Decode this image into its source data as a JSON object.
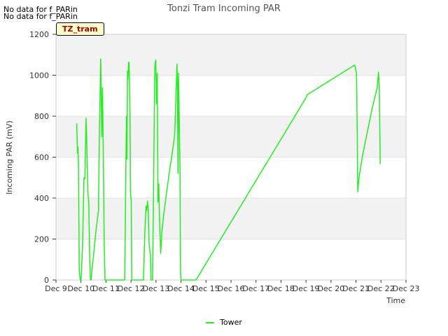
{
  "notes": [
    "No data for f_PARin",
    "No data for f_PARin"
  ],
  "site_tag": "TZ_tram",
  "colors": {
    "series": "#22ee22",
    "band": "#f2f2f2",
    "grid": "#dddddd"
  },
  "chart_data": {
    "type": "line",
    "title": "Tonzi Tram Incoming PAR",
    "xlabel": "Time",
    "ylabel": "Incoming PAR (mV)",
    "xlim": [
      9,
      23
    ],
    "ylim": [
      0,
      1200
    ],
    "x_ticks": [
      9,
      10,
      11,
      12,
      13,
      14,
      15,
      16,
      17,
      18,
      19,
      20,
      21,
      22,
      23
    ],
    "x_tick_labels": [
      "Dec 9",
      "Dec 10",
      "Dec 11",
      "Dec 12",
      "Dec 13",
      "Dec 14",
      "Dec 15",
      "Dec 16",
      "Dec 17",
      "Dec 18",
      "Dec 19",
      "Dec 20",
      "Dec 21",
      "Dec 22",
      "Dec 23"
    ],
    "y_ticks": [
      0,
      200,
      400,
      600,
      800,
      1000,
      1200
    ],
    "y_tick_labels": [
      "0",
      "200",
      "400",
      "600",
      "800",
      "1000",
      "1200"
    ],
    "grid": true,
    "legend_position": "bottom-center",
    "series": [
      {
        "name": "Tower",
        "x": [
          9.83,
          9.86,
          9.88,
          9.9,
          9.93,
          9.97,
          10.0,
          10.06,
          10.12,
          10.16,
          10.2,
          10.22,
          10.24,
          10.28,
          10.31,
          10.35,
          10.38,
          10.4,
          10.45,
          10.5,
          10.55,
          10.6,
          10.65,
          10.7,
          10.74,
          10.79,
          10.83,
          10.86,
          10.89,
          10.91,
          10.93,
          10.96,
          10.98,
          11.01,
          11.04,
          11.08,
          11.13,
          11.5,
          11.75,
          11.8,
          11.82,
          11.84,
          11.86,
          11.88,
          11.9,
          11.92,
          11.94,
          11.96,
          11.98,
          12.01,
          12.03,
          12.05,
          12.07,
          12.09,
          12.5,
          12.55,
          12.6,
          12.63,
          12.66,
          12.69,
          12.72,
          12.75,
          12.78,
          12.8,
          12.83,
          12.86,
          12.9,
          12.95,
          12.99,
          13.02,
          13.05,
          13.08,
          13.11,
          13.14,
          13.16,
          13.19,
          13.23,
          13.29,
          13.35,
          13.45,
          13.55,
          13.65,
          13.75,
          13.84,
          13.86,
          13.88,
          13.9,
          13.92,
          13.94,
          13.96,
          13.98,
          14.0,
          14.02,
          14.05,
          14.08,
          14.2,
          14.6,
          19.0,
          19.05,
          20.95,
          21.02,
          21.05,
          21.07,
          21.12,
          21.25,
          21.45,
          21.65,
          21.85,
          21.9,
          21.93,
          21.95,
          21.97
        ],
        "values": [
          765,
          620,
          650,
          560,
          50,
          0,
          0,
          160,
          500,
          495,
          790,
          720,
          600,
          420,
          380,
          100,
          0,
          0,
          60,
          120,
          180,
          240,
          290,
          340,
          740,
          1080,
          700,
          940,
          640,
          420,
          180,
          0,
          0,
          0,
          0,
          0,
          0,
          0,
          0,
          600,
          800,
          590,
          1020,
          980,
          1060,
          1065,
          980,
          820,
          420,
          390,
          0,
          0,
          0,
          0,
          0,
          220,
          360,
          340,
          385,
          340,
          185,
          150,
          120,
          0,
          0,
          0,
          420,
          1040,
          1075,
          860,
          1010,
          380,
          470,
          300,
          220,
          130,
          230,
          300,
          360,
          450,
          540,
          620,
          710,
          1055,
          920,
          520,
          1010,
          870,
          700,
          560,
          40,
          0,
          0,
          0,
          0,
          0,
          0,
          890,
          905,
          1050,
          1010,
          700,
          430,
          500,
          600,
          720,
          840,
          940,
          1015,
          950,
          760,
          565
        ]
      }
    ]
  },
  "legend": {
    "label": "Tower"
  }
}
